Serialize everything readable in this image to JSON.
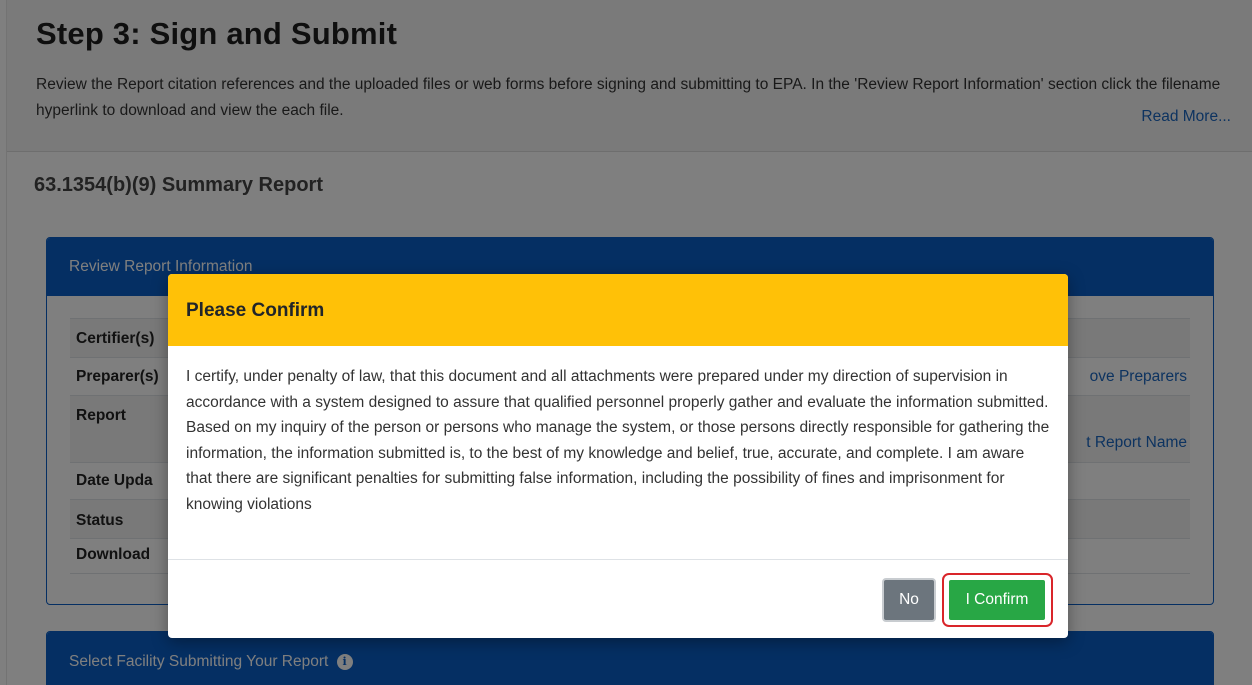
{
  "step": {
    "title": "Step 3: Sign and Submit",
    "description": "Review the Report citation references and the uploaded files or web forms before signing and submitting to EPA. In the 'Review Report Information' section click the filename hyperlink to download and view the each file.",
    "read_more": "Read More..."
  },
  "report": {
    "title": "63.1354(b)(9) Summary Report"
  },
  "review_card": {
    "header": "Review Report Information",
    "rows": {
      "certifiers": {
        "label": "Certifier(s)"
      },
      "preparers": {
        "label": "Preparer(s)",
        "link": "ove Preparers"
      },
      "report": {
        "label": "Report",
        "link": "t Report Name"
      },
      "date_updated": {
        "label": "Date Upda"
      },
      "status": {
        "label": "Status"
      },
      "download": {
        "label": "Download"
      }
    }
  },
  "facility_card": {
    "header": "Select Facility Submitting Your Report",
    "info_icon": "info-circle-icon"
  },
  "modal": {
    "title": "Please Confirm",
    "body": "I certify, under penalty of law, that this document and all attachments were prepared under my direction of supervision in accordance with a system designed to assure that qualified personnel properly gather and evaluate the information submitted. Based on my inquiry of the person or persons who manage the system, or those persons directly responsible for gathering the information, the information submitted is, to the best of my knowledge and belief, true, accurate, and complete. I am aware that there are significant penalties for submitting false information, including the possibility of fines and imprisonment for knowing violations",
    "no_label": "No",
    "confirm_label": "I Confirm"
  },
  "colors": {
    "primary_blue": "#0b5fc6",
    "warning_yellow": "#ffc107",
    "success_green": "#28a745",
    "secondary_gray": "#6c757d",
    "highlight_red": "#d9252a"
  }
}
